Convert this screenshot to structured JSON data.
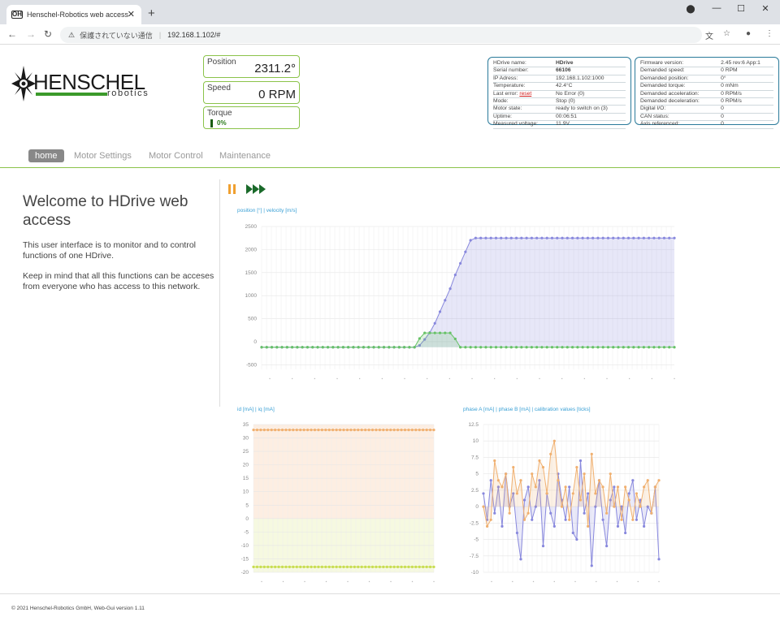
{
  "browser": {
    "tab_title": "Henschel-Robotics web access",
    "favicon": "OH",
    "url_security": "保護されていない通信",
    "url": "192.168.1.102/#"
  },
  "logo": {
    "name": "HENSCHEL",
    "sub": "robotics"
  },
  "status": {
    "position_label": "Position",
    "position_value": "2311.2°",
    "speed_label": "Speed",
    "speed_value": "0 RPM",
    "torque_label": "Torque",
    "torque_value": "0%"
  },
  "info_left": [
    [
      "HDrive name:",
      "HDrive"
    ],
    [
      "Serial number:",
      "66106"
    ],
    [
      "IP Adress:",
      "192.168.1.102:1000"
    ],
    [
      "Temperature:",
      "42.4°C"
    ],
    [
      "Last error:",
      "No Error (0)"
    ],
    [
      "Mode:",
      "Stop (0)"
    ],
    [
      "Motor state:",
      "ready to switch on (3)"
    ],
    [
      "Uptime:",
      "00:06:51"
    ],
    [
      "Measured voltage:",
      "11.9V"
    ]
  ],
  "info_reset": "reset",
  "info_right": [
    [
      "Firmware version:",
      "2.45 rev:6 App:1"
    ],
    [
      "Demanded speed:",
      "0 RPM"
    ],
    [
      "Demanded position:",
      "0°"
    ],
    [
      "Demanded torque:",
      "0 mNm"
    ],
    [
      "Demanded acceleration:",
      "0 RPM/s"
    ],
    [
      "Demanded deceleration:",
      "0 RPM/s"
    ],
    [
      "Digital I/O:",
      "0"
    ],
    [
      "CAN status:",
      "0"
    ],
    [
      "Axis referenced:",
      "0"
    ]
  ],
  "menu": [
    "home",
    "Motor Settings",
    "Motor Control",
    "Maintenance"
  ],
  "welcome": {
    "title": "Welcome to HDrive web access",
    "p1": "This user interface is to monitor and to control functions of one HDrive.",
    "p2": "Keep in mind that all this functions can be acceses from everyone who has access to this network."
  },
  "footer": "© 2021 Henschel-Robotics GmbH, Web-Gui version 1.11",
  "icons": {
    "pause": "pause-icon",
    "forward": "fast-forward-icon"
  },
  "colors": {
    "green": "#8bc34a",
    "blue": "#3aa0d5",
    "purple": "#8888dd",
    "series_green": "#66c266",
    "orange": "#f0b070",
    "yellow": "#c8dd50"
  },
  "chart_data": [
    {
      "type": "line",
      "legend": "position [°] | velocity [m/s]",
      "yticks": [
        2500,
        2000,
        1500,
        1000,
        500,
        0,
        -500
      ],
      "ylim": [
        -600,
        2500
      ],
      "series": [
        {
          "name": "position [°]",
          "values": [
            -120,
            -120,
            -120,
            -120,
            -120,
            -120,
            -120,
            -120,
            -120,
            -120,
            -120,
            -120,
            -120,
            -120,
            -120,
            -120,
            -120,
            -120,
            -120,
            -120,
            -120,
            -120,
            -120,
            -120,
            -120,
            -120,
            -120,
            -120,
            -120,
            -120,
            -120,
            -80,
            50,
            200,
            400,
            650,
            900,
            1150,
            1450,
            1700,
            1950,
            2200,
            2250,
            2250,
            2250,
            2250,
            2250,
            2250,
            2250,
            2250,
            2250,
            2250,
            2250,
            2250,
            2250,
            2250,
            2250,
            2250,
            2250,
            2250,
            2250,
            2250,
            2250,
            2250,
            2250,
            2250,
            2250,
            2250,
            2250,
            2250,
            2250,
            2250,
            2250,
            2250,
            2250,
            2250,
            2250,
            2250,
            2250,
            2250,
            2250,
            2250
          ]
        },
        {
          "name": "velocity [m/s]",
          "values": [
            -120,
            -120,
            -120,
            -120,
            -120,
            -120,
            -120,
            -120,
            -120,
            -120,
            -120,
            -120,
            -120,
            -120,
            -120,
            -120,
            -120,
            -120,
            -120,
            -120,
            -120,
            -120,
            -120,
            -120,
            -120,
            -120,
            -120,
            -120,
            -120,
            -120,
            -120,
            70,
            190,
            190,
            190,
            190,
            190,
            190,
            60,
            -120,
            -120,
            -120,
            -120,
            -120,
            -120,
            -120,
            -120,
            -120,
            -120,
            -120,
            -120,
            -120,
            -120,
            -120,
            -120,
            -120,
            -120,
            -120,
            -120,
            -120,
            -120,
            -120,
            -120,
            -120,
            -120,
            -120,
            -120,
            -120,
            -120,
            -120,
            -120,
            -120,
            -120,
            -120,
            -120,
            -120,
            -120,
            -120,
            -120,
            -120,
            -120,
            -120
          ]
        }
      ]
    },
    {
      "type": "line",
      "legend": "id [mA] | iq [mA]",
      "yticks": [
        35,
        30,
        25,
        20,
        15,
        10,
        5,
        0,
        -5,
        -10,
        -15,
        -20
      ],
      "ylim": [
        -20,
        35
      ],
      "series": [
        {
          "name": "id [mA]",
          "values": [
            33,
            33,
            33,
            33,
            33,
            33,
            33,
            33,
            33,
            33,
            33,
            33,
            33,
            33,
            33,
            33,
            33,
            33,
            33,
            33,
            33,
            33,
            33,
            33,
            33,
            33,
            33,
            33,
            33,
            33,
            33,
            33,
            33,
            33,
            33,
            33,
            33,
            33,
            33,
            33,
            33,
            33,
            33,
            33,
            33,
            33,
            33,
            33,
            33,
            33,
            33
          ]
        },
        {
          "name": "iq [mA]",
          "values": [
            -18,
            -18,
            -18,
            -18,
            -18,
            -18,
            -18,
            -18,
            -18,
            -18,
            -18,
            -18,
            -18,
            -18,
            -18,
            -18,
            -18,
            -18,
            -18,
            -18,
            -18,
            -18,
            -18,
            -18,
            -18,
            -18,
            -18,
            -18,
            -18,
            -18,
            -18,
            -18,
            -18,
            -18,
            -18,
            -18,
            -18,
            -18,
            -18,
            -18,
            -18,
            -18,
            -18,
            -18,
            -18,
            -18,
            -18,
            -18,
            -18,
            -18,
            -18
          ]
        }
      ]
    },
    {
      "type": "line",
      "legend": "phase A [mA] | phase B [mA] | calibration values [ticks]",
      "yticks": [
        12.5,
        10,
        7.5,
        5,
        2.5,
        0,
        -2.5,
        -5,
        -7.5,
        -10
      ],
      "ylim": [
        -10,
        12.5
      ],
      "series": [
        {
          "name": "phase A [mA]",
          "values": [
            2,
            -2,
            4,
            -1,
            3,
            -3,
            5,
            0,
            2,
            -4,
            -8,
            1,
            3,
            -2,
            0,
            4,
            -6,
            2,
            -1,
            -3,
            5,
            1,
            -2,
            3,
            -4,
            -5,
            7,
            -1,
            2,
            -9,
            0,
            4,
            -2,
            -6,
            1,
            3,
            -3,
            0,
            -4,
            2,
            4,
            -2,
            1,
            -3,
            0,
            -1,
            3,
            -8
          ]
        },
        {
          "name": "phase B [mA]",
          "values": [
            0,
            -3,
            -2,
            7,
            4,
            3,
            5,
            -1,
            6,
            2,
            4,
            -2,
            -1,
            5,
            3,
            7,
            6,
            2,
            8,
            10,
            4,
            0,
            3,
            -2,
            2,
            6,
            1,
            5,
            -3,
            8,
            2,
            4,
            3,
            -1,
            5,
            0,
            3,
            -2,
            3,
            1,
            -2,
            2,
            0,
            3,
            4,
            -1,
            3,
            4
          ]
        }
      ]
    }
  ]
}
